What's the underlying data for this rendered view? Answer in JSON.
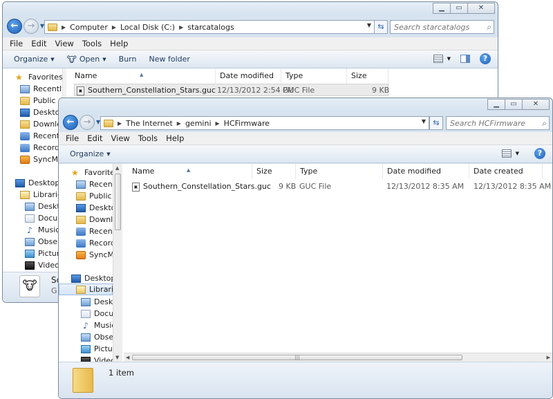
{
  "back_window": {
    "address": {
      "crumbs": [
        "Computer",
        "Local Disk (C:)",
        "starcatalogs"
      ]
    },
    "search": {
      "placeholder": "Search starcatalogs"
    },
    "menu": [
      "File",
      "Edit",
      "View",
      "Tools",
      "Help"
    ],
    "commands": {
      "organize": "Organize",
      "open": "Open",
      "burn": "Burn",
      "new_folder": "New folder"
    },
    "nav": {
      "favorites": "Favorites",
      "items": [
        "Recently",
        "Public",
        "Desktop",
        "Downloa",
        "Recent P",
        "Recorded",
        "SyncMe"
      ],
      "desktop": "Desktop",
      "libraries": "Libraries",
      "lib_items": [
        "Deskto",
        "Docum",
        "Music",
        "Observ",
        "Pictures",
        "Videos"
      ]
    },
    "columns": {
      "name": "Name",
      "date_modified": "Date modified",
      "type": "Type",
      "size": "Size"
    },
    "files": [
      {
        "name": "Southern_Constellation_Stars.guc",
        "date_modified": "12/13/2012 2:54 PM",
        "type": "GUC File",
        "size": "9 KB"
      }
    ],
    "details": {
      "name_partial": "Sc",
      "type_partial": "G"
    }
  },
  "front_window": {
    "address": {
      "crumbs": [
        "The Internet",
        "gemini",
        "HCFirmware"
      ]
    },
    "search": {
      "placeholder": "Search HCFirmware"
    },
    "menu": [
      "File",
      "Edit",
      "View",
      "Tools",
      "Help"
    ],
    "commands": {
      "organize": "Organize"
    },
    "nav": {
      "favorites": "Favorites",
      "items": [
        "Recently",
        "Public",
        "Desktop",
        "Downloa",
        "Recent P",
        "Recorde",
        "SyncMe"
      ],
      "desktop": "Desktop",
      "libraries": "Libraries",
      "lib_items": [
        "Deskto",
        "Docum",
        "Music",
        "Observ",
        "Pictures",
        "Videos"
      ]
    },
    "columns": {
      "name": "Name",
      "size": "Size",
      "type": "Type",
      "date_modified": "Date modified",
      "date_created": "Date created"
    },
    "files": [
      {
        "name": "Southern_Constellation_Stars.guc",
        "size": "9 KB",
        "type": "GUC File",
        "date_modified": "12/13/2012 8:35 AM",
        "date_created": "12/13/2012 8:35 AM"
      }
    ],
    "details": {
      "count": "1 item"
    }
  },
  "icons": {
    "back": "back-arrow-icon",
    "forward": "forward-arrow-icon",
    "refresh": "refresh-icon",
    "search": "search-icon",
    "help": "help-icon",
    "views": "views-icon",
    "preview_pane": "preview-pane-icon"
  },
  "colors": {
    "accent": "#1b5fb8",
    "selection": "#d6e5f8",
    "folder": "#e4b84b"
  }
}
